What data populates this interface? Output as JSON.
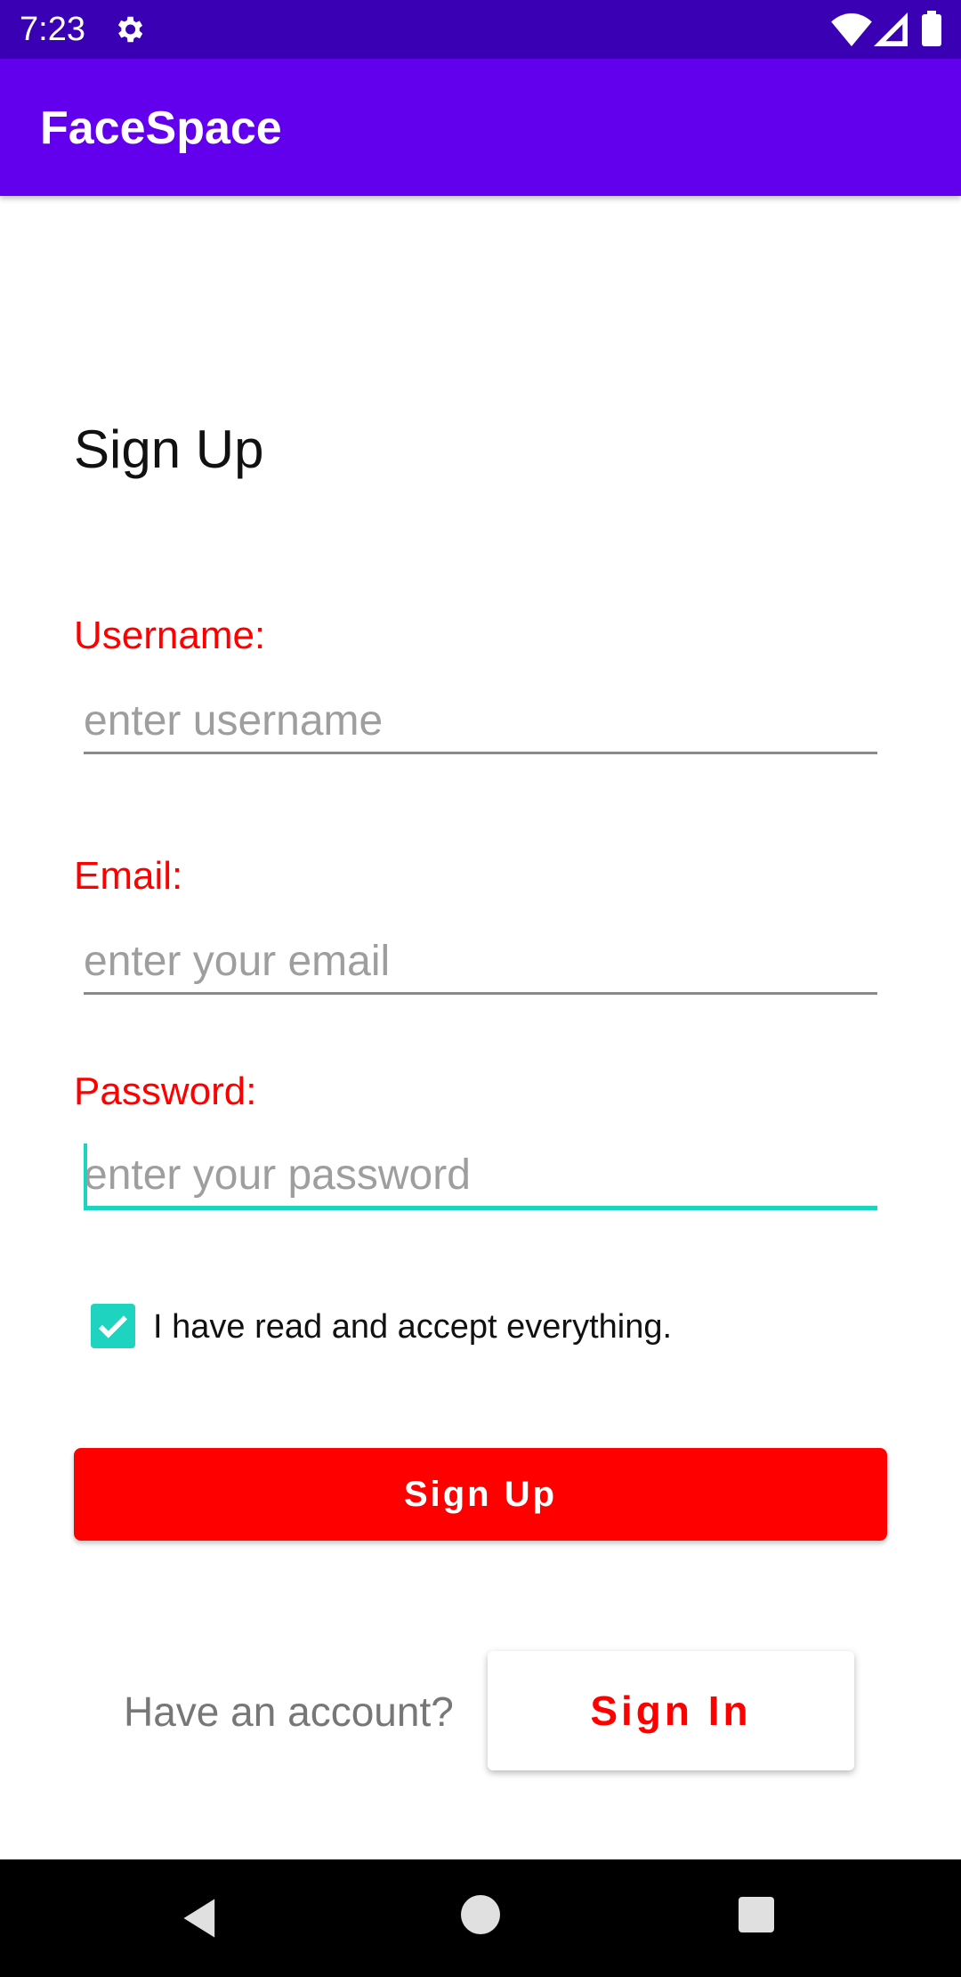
{
  "status_bar": {
    "time": "7:23"
  },
  "app_bar": {
    "title": "FaceSpace"
  },
  "form": {
    "heading": "Sign Up",
    "username": {
      "label": "Username:",
      "placeholder": "enter username",
      "value": ""
    },
    "email": {
      "label": "Email:",
      "placeholder": "enter your email",
      "value": ""
    },
    "password": {
      "label": "Password:",
      "placeholder": "enter your password",
      "value": ""
    },
    "accept": {
      "label": "I have read and accept everything.",
      "checked": true
    },
    "signup_label": "Sign Up"
  },
  "footer": {
    "prompt": "Have an account?",
    "signin_label": "Sign In"
  },
  "colors": {
    "status_bar": "#3a00b4",
    "app_bar": "#6200ee",
    "accent_red": "#ff0000",
    "accent_teal": "#1ed4c0"
  }
}
